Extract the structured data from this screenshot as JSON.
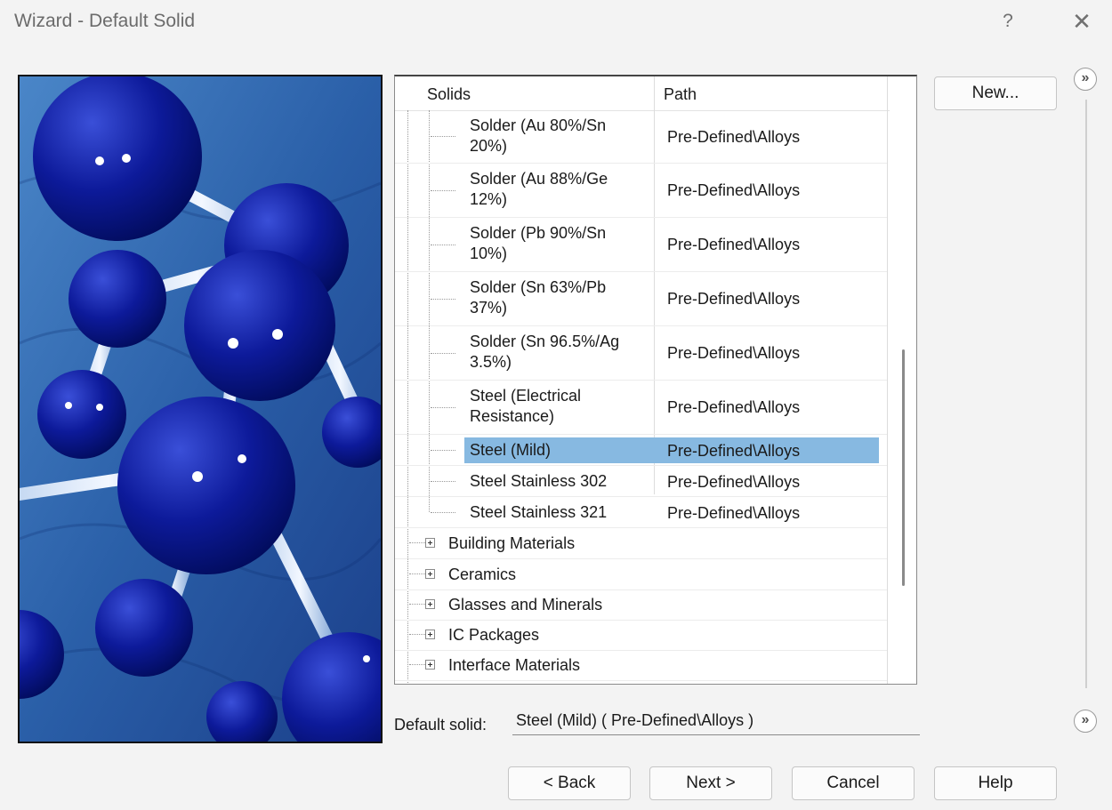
{
  "window": {
    "title": "Wizard - Default Solid",
    "help_glyph": "?",
    "close_glyph": "✕"
  },
  "grid": {
    "columns": [
      "Solids",
      "Path"
    ],
    "rows": [
      {
        "name_line1": "Solder (Au 80%/Sn",
        "name_line2": "20%)",
        "path": "Pre-Defined\\Alloys",
        "selected": false
      },
      {
        "name_line1": "Solder (Au 88%/Ge",
        "name_line2": "12%)",
        "path": "Pre-Defined\\Alloys",
        "selected": false
      },
      {
        "name_line1": "Solder (Pb 90%/Sn",
        "name_line2": "10%)",
        "path": "Pre-Defined\\Alloys",
        "selected": false
      },
      {
        "name_line1": "Solder (Sn 63%/Pb",
        "name_line2": "37%)",
        "path": "Pre-Defined\\Alloys",
        "selected": false
      },
      {
        "name_line1": "Solder (Sn 96.5%/Ag",
        "name_line2": "3.5%)",
        "path": "Pre-Defined\\Alloys",
        "selected": false
      },
      {
        "name_line1": "Steel (Electrical",
        "name_line2": "Resistance)",
        "path": "Pre-Defined\\Alloys",
        "selected": false
      },
      {
        "name_line1": "Steel (Mild)",
        "name_line2": "",
        "path": "Pre-Defined\\Alloys",
        "selected": true
      },
      {
        "name_line1": "Steel Stainless 302",
        "name_line2": "",
        "path": "Pre-Defined\\Alloys",
        "selected": false
      },
      {
        "name_line1": "Steel Stainless 321",
        "name_line2": "",
        "path": "Pre-Defined\\Alloys",
        "selected": false
      }
    ],
    "categories": [
      {
        "label": "Building Materials"
      },
      {
        "label": "Ceramics"
      },
      {
        "label": "Glasses and Minerals"
      },
      {
        "label": "IC Packages"
      },
      {
        "label": "Interface Materials"
      }
    ]
  },
  "default_solid": {
    "label": "Default solid:",
    "value": "Steel (Mild) ( Pre-Defined\\Alloys )"
  },
  "buttons": {
    "new": "New...",
    "back": "< Back",
    "next": "Next >",
    "cancel": "Cancel",
    "help": "Help"
  },
  "side": {
    "expand_glyph": "»"
  },
  "colors": {
    "selection": "#87b9e1",
    "window_bg": "#f3f3f3"
  }
}
